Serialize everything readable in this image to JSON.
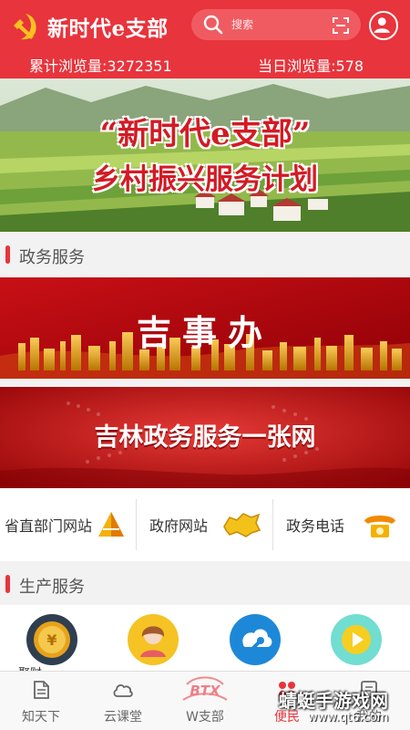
{
  "header": {
    "brand_title": "新时代e支部",
    "search_placeholder": "搜索",
    "stats": {
      "total_label": "累计浏览量:3272351",
      "today_label": "当日浏览量:578"
    }
  },
  "banner": {
    "title_line1": "“新时代e支部”",
    "title_line2": "乡村振兴服务计划"
  },
  "sections": {
    "government": {
      "title": "政务服务"
    },
    "production": {
      "title": "生产服务"
    }
  },
  "service_banners": [
    {
      "text": "吉事办"
    },
    {
      "text": "吉林政务服务一张网"
    }
  ],
  "links": [
    {
      "label": "省直部门网站",
      "icon": "pyramid-icon"
    },
    {
      "label": "政府网站",
      "icon": "jilin-map-icon"
    },
    {
      "label": "政务电话",
      "icon": "telephone-icon"
    }
  ],
  "production_items": [
    {
      "icon": "coin-icon",
      "color": "#2f3f4f",
      "label": "聚财"
    },
    {
      "icon": "person-icon",
      "color": "#f5c324",
      "label": ""
    },
    {
      "icon": "cloud-tools-icon",
      "color": "#1e88d8",
      "label": ""
    },
    {
      "icon": "play-icon",
      "color": "#72ddd1",
      "label": ""
    }
  ],
  "bottom_nav": [
    {
      "label": "知天下",
      "icon": "document-icon",
      "active": false
    },
    {
      "label": "云课堂",
      "icon": "cloud-icon",
      "active": false
    },
    {
      "label": "W支部",
      "icon": "btx-logo-icon",
      "active": false
    },
    {
      "label": "便民",
      "icon": "grid-icon",
      "active": true
    },
    {
      "label": "我的",
      "icon": "message-icon",
      "active": false
    }
  ],
  "watermark": {
    "text": "蜻蜓手游戏网",
    "url": "www.qt6.com"
  },
  "colors": {
    "primary": "#e8343c",
    "search_bg": "#f05b62",
    "section_bg": "#f2f2f2",
    "nav_active": "#e8343c"
  }
}
